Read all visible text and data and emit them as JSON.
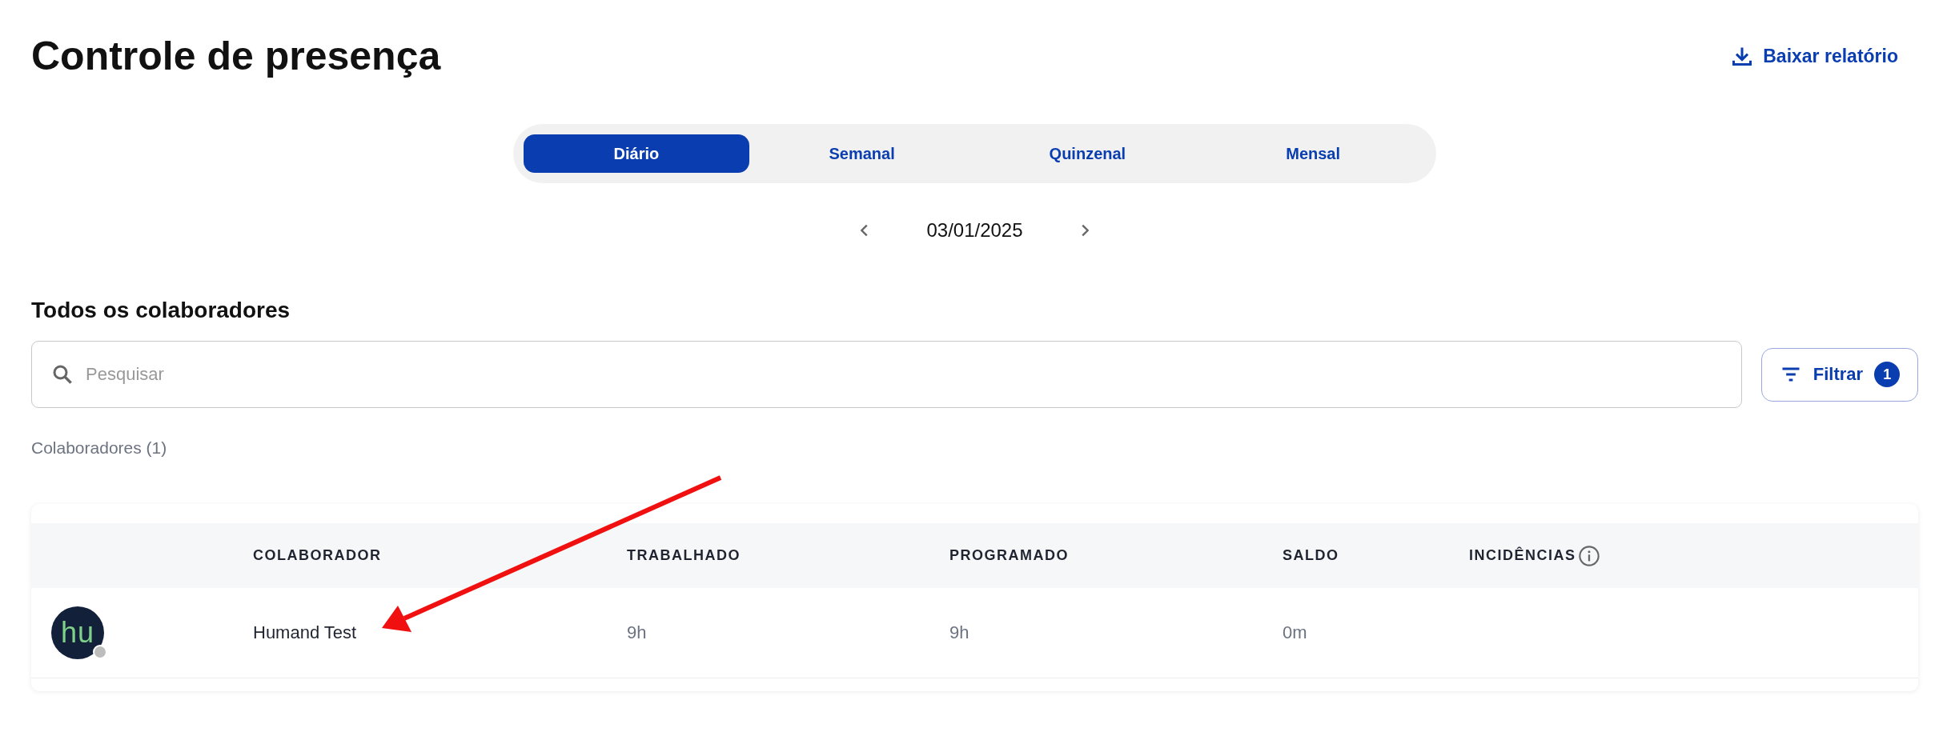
{
  "header": {
    "title": "Controle de presença",
    "download_label": "Baixar relatório"
  },
  "periods": [
    {
      "label": "Diário",
      "selected": true
    },
    {
      "label": "Semanal",
      "selected": false
    },
    {
      "label": "Quinzenal",
      "selected": false
    },
    {
      "label": "Mensal",
      "selected": false
    }
  ],
  "date": "03/01/2025",
  "section_title": "Todos os colaboradores",
  "search": {
    "placeholder": "Pesquisar"
  },
  "filter": {
    "label": "Filtrar",
    "count": "1"
  },
  "count_label": "Colaboradores (1)",
  "table": {
    "columns": [
      "COLABORADOR",
      "TRABALHADO",
      "PROGRAMADO",
      "SALDO",
      "INCIDÊNCIAS"
    ],
    "rows": [
      {
        "avatar": "hu",
        "online": false,
        "name": "Humand Test",
        "worked": "9h",
        "scheduled": "9h",
        "balance": "0m"
      }
    ]
  }
}
